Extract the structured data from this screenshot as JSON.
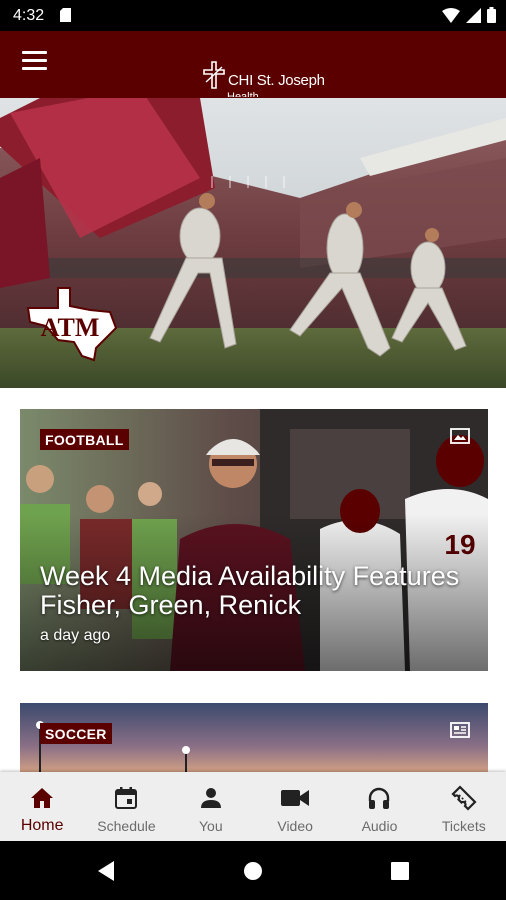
{
  "status_bar": {
    "time": "4:32",
    "icons": [
      "sd-card-icon",
      "wifi-icon",
      "cell-signal-icon",
      "battery-icon"
    ]
  },
  "app_bar": {
    "menu_icon": "hamburger-menu-icon",
    "brand_name": "CHI St. Joseph",
    "brand_sub": "Health",
    "color": "#5b0000"
  },
  "hero": {
    "logo_text": "ATM",
    "logo_icon": "texas-am-logo"
  },
  "cards": [
    {
      "category": "FOOTBALL",
      "title": "Week 4 Media Availability Features Fisher, Green, Renick",
      "time": "a day ago",
      "media_icon": "gallery-icon"
    },
    {
      "category": "SOCCER",
      "media_icon": "news-article-icon"
    }
  ],
  "bottom_nav": {
    "items": [
      {
        "label": "Home",
        "icon": "home-icon",
        "active": true
      },
      {
        "label": "Schedule",
        "icon": "calendar-icon",
        "active": false
      },
      {
        "label": "You",
        "icon": "person-icon",
        "active": false
      },
      {
        "label": "Video",
        "icon": "video-camera-icon",
        "active": false
      },
      {
        "label": "Audio",
        "icon": "headphones-icon",
        "active": false
      },
      {
        "label": "Tickets",
        "icon": "ticket-icon",
        "active": false
      }
    ],
    "active_color": "#5b0000",
    "inactive_color": "#6b6b6b"
  },
  "system_nav": {
    "buttons": [
      "back-icon",
      "home-circle-icon",
      "recents-icon"
    ]
  }
}
